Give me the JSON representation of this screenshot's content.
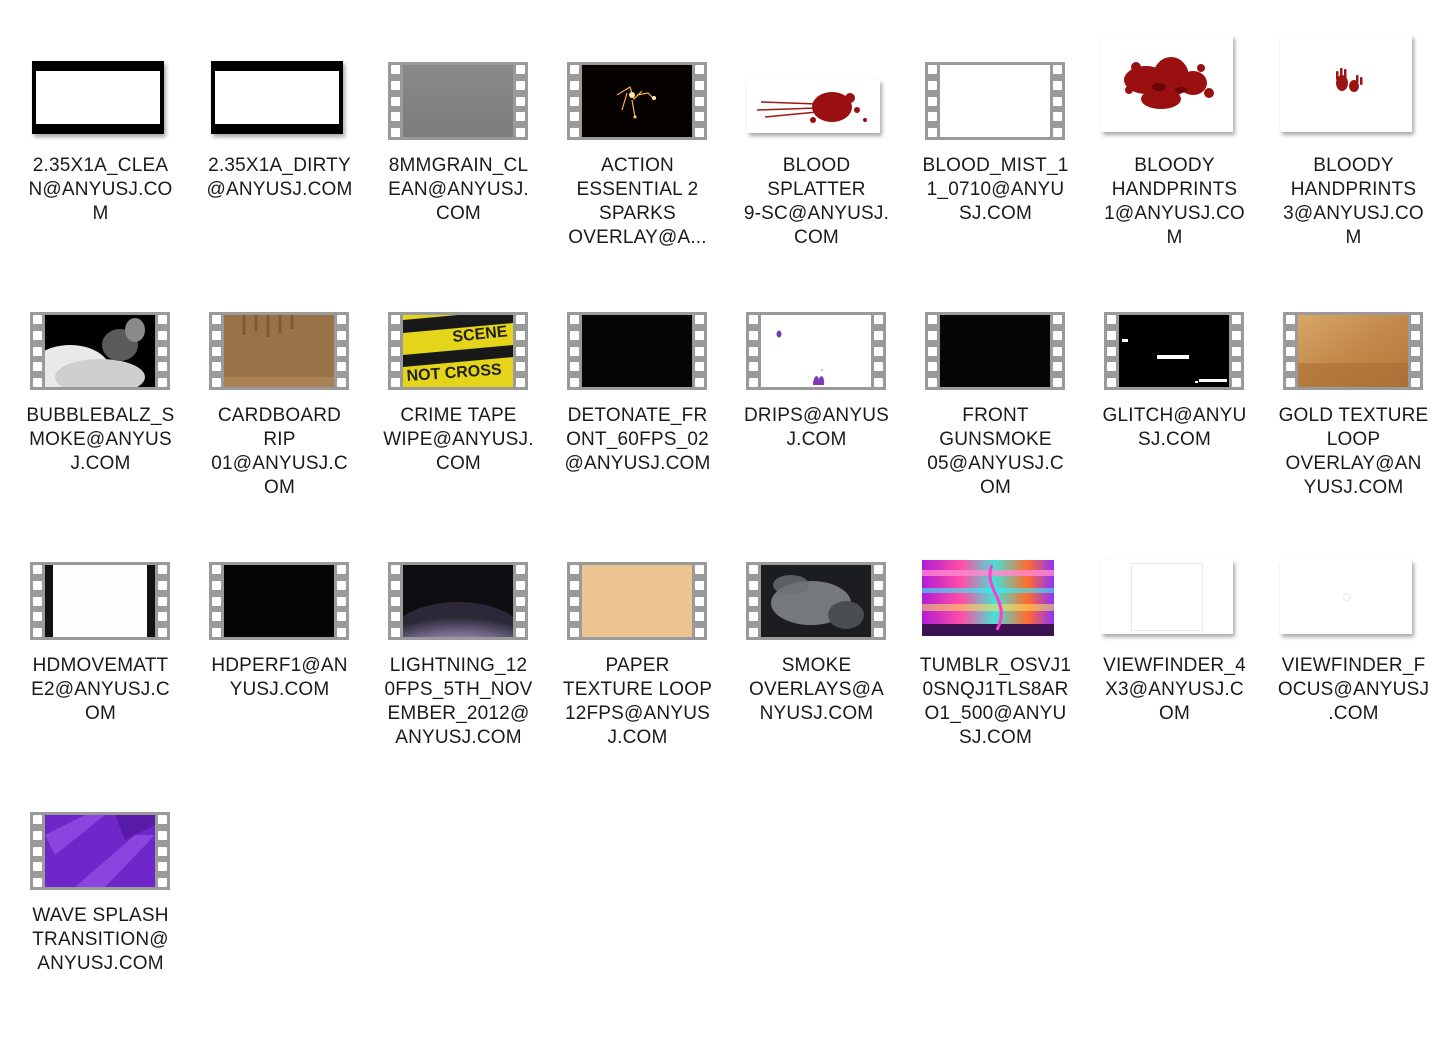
{
  "files": [
    {
      "name": "2.35X1A_CLEAN@ANYUSJ.COM",
      "lines": [
        "2.35X1A_CLEA",
        "N@ANYUSJ.CO",
        "M"
      ],
      "thumb": "plain",
      "style": "letterbox"
    },
    {
      "name": "2.35X1A_DIRTY@ANYUSJ.COM",
      "lines": [
        "2.35X1A_DIRTY",
        "@ANYUSJ.COM"
      ],
      "thumb": "plain",
      "style": "letterbox"
    },
    {
      "name": "8MMGRAIN_CLEAN@ANYUSJ.COM",
      "lines": [
        "8MMGRAIN_CL",
        "EAN@ANYUSJ.",
        "COM"
      ],
      "thumb": "video",
      "style": "gray"
    },
    {
      "name": "ACTION ESSENTIAL 2 SPARKS OVERLAY@A...",
      "lines": [
        "ACTION",
        "ESSENTIAL 2",
        "SPARKS",
        "OVERLAY@A..."
      ],
      "thumb": "video",
      "style": "sparks"
    },
    {
      "name": "BLOOD SPLATTER 9-SC@ANYUSJ.COM",
      "lines": [
        "BLOOD",
        "SPLATTER",
        "9-SC@ANYUSJ.",
        "COM"
      ],
      "thumb": "image",
      "style": "splatter"
    },
    {
      "name": "BLOOD_MIST_11_0710@ANYUSJ.COM",
      "lines": [
        "BLOOD_MIST_1",
        "1_0710@ANYU",
        "SJ.COM"
      ],
      "thumb": "video",
      "style": "white"
    },
    {
      "name": "BLOODY HANDPRINTS 1@ANYUSJ.COM",
      "lines": [
        "BLOODY",
        "HANDPRINTS",
        "1@ANYUSJ.CO",
        "M"
      ],
      "thumb": "image",
      "style": "handprints1"
    },
    {
      "name": "BLOODY HANDPRINTS 3@ANYUSJ.COM",
      "lines": [
        "BLOODY",
        "HANDPRINTS",
        "3@ANYUSJ.CO",
        "M"
      ],
      "thumb": "image",
      "style": "handprints3"
    },
    {
      "name": "BUBBLEBALZ_SMOKE@ANYUSJ.COM",
      "lines": [
        "BUBBLEBALZ_S",
        "MOKE@ANYUS",
        "J.COM"
      ],
      "thumb": "video",
      "style": "smokewhite"
    },
    {
      "name": "CARDBOARD RIP 01@ANYUSJ.COM",
      "lines": [
        "CARDBOARD",
        "RIP",
        "01@ANYUSJ.C",
        "OM"
      ],
      "thumb": "video",
      "style": "cardboard"
    },
    {
      "name": "CRIME TAPE WIPE@ANYUSJ.COM",
      "lines": [
        "CRIME TAPE",
        "WIPE@ANYUSJ.",
        "COM"
      ],
      "thumb": "video",
      "style": "crimetape"
    },
    {
      "name": "DETONATE_FRONT_60FPS_02@ANYUSJ.COM",
      "lines": [
        "DETONATE_FR",
        "ONT_60FPS_02",
        "@ANYUSJ.COM"
      ],
      "thumb": "video",
      "style": "black"
    },
    {
      "name": "DRIPS@ANYUSJ.COM",
      "lines": [
        "DRIPS@ANYUS",
        "J.COM"
      ],
      "thumb": "video",
      "style": "drips"
    },
    {
      "name": "FRONT GUNSMOKE 05@ANYUSJ.COM",
      "lines": [
        "FRONT",
        "GUNSMOKE",
        "05@ANYUSJ.C",
        "OM"
      ],
      "thumb": "video",
      "style": "black"
    },
    {
      "name": "GLITCH@ANYUSJ.COM",
      "lines": [
        "GLITCH@ANYU",
        "SJ.COM"
      ],
      "thumb": "video",
      "style": "glitch"
    },
    {
      "name": "GOLD TEXTURE LOOP OVERLAY@ANYUSJ.COM",
      "lines": [
        "GOLD TEXTURE",
        "LOOP",
        "OVERLAY@AN",
        "YUSJ.COM"
      ],
      "thumb": "video",
      "style": "gold"
    },
    {
      "name": "HDMOVEMATTE2@ANYUSJ.COM",
      "lines": [
        "HDMOVEMATT",
        "E2@ANYUSJ.C",
        "OM"
      ],
      "thumb": "video",
      "style": "matte"
    },
    {
      "name": "HDPERF1@ANYUSJ.COM",
      "lines": [
        "HDPERF1@AN",
        "YUSJ.COM"
      ],
      "thumb": "video",
      "style": "black"
    },
    {
      "name": "LIGHTNING_120FPS_5TH_NOVEMBER_2012@ANYUSJ.COM",
      "lines": [
        "LIGHTNING_12",
        "0FPS_5TH_NOV",
        "EMBER_2012@",
        "ANYUSJ.COM"
      ],
      "thumb": "video",
      "style": "lightning"
    },
    {
      "name": "PAPER TEXTURE LOOP 12FPS@ANYUSJ.COM",
      "lines": [
        "PAPER",
        "TEXTURE LOOP",
        "12FPS@ANYUS",
        "J.COM"
      ],
      "thumb": "video",
      "style": "paper"
    },
    {
      "name": "SMOKE OVERLAYS@ANYUSJ.COM",
      "lines": [
        "SMOKE",
        "OVERLAYS@A",
        "NYUSJ.COM"
      ],
      "thumb": "video",
      "style": "smokedark"
    },
    {
      "name": "TUMBLR_OSVJ10SNQJ1TLS8ARO1_500@ANYUSJ.COM",
      "lines": [
        "TUMBLR_OSVJ1",
        "0SNQJ1TLS8AR",
        "O1_500@ANYU",
        "SJ.COM"
      ],
      "thumb": "plain",
      "style": "tumblr"
    },
    {
      "name": "VIEWFINDER_4X3@ANYUSJ.COM",
      "lines": [
        "VIEWFINDER_4",
        "X3@ANYUSJ.C",
        "OM"
      ],
      "thumb": "image",
      "style": "viewfinder"
    },
    {
      "name": "VIEWFINDER_FOCUS@ANYUSJ.COM",
      "lines": [
        "VIEWFINDER_F",
        "OCUS@ANYUSJ",
        ".COM"
      ],
      "thumb": "image",
      "style": "focus"
    },
    {
      "name": "WAVE SPLASH TRANSITION@ANYUSJ.COM",
      "lines": [
        "WAVE SPLASH",
        "TRANSITION@",
        "ANYUSJ.COM"
      ],
      "thumb": "video",
      "style": "purple"
    }
  ]
}
